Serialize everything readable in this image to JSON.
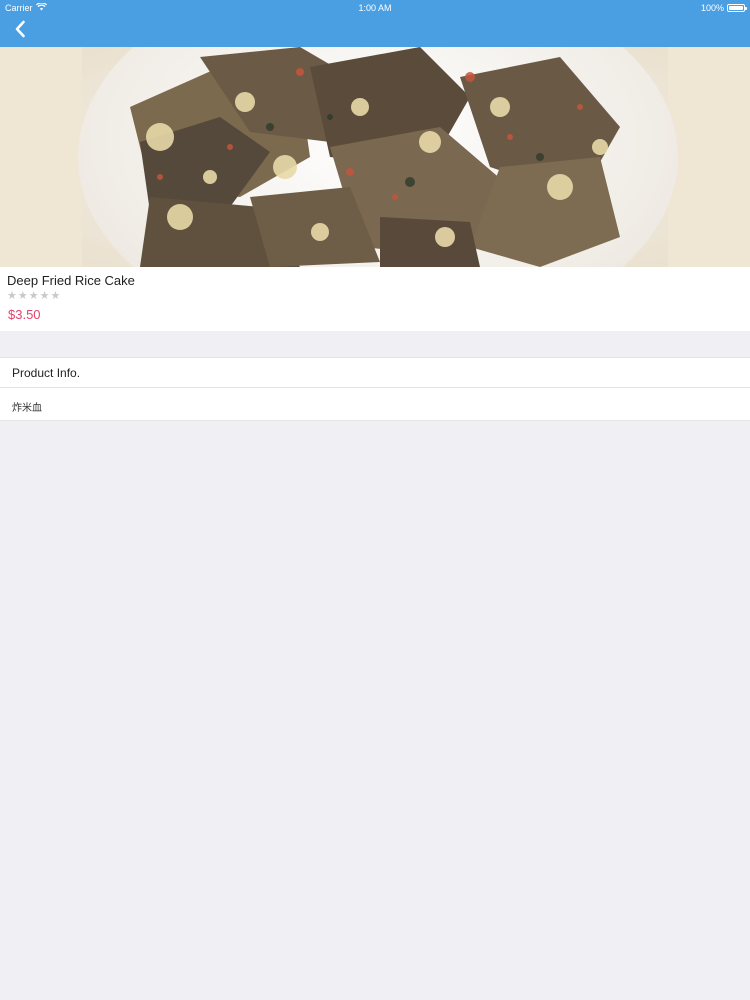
{
  "status_bar": {
    "carrier": "Carrier",
    "time": "1:00 AM",
    "battery": "100%",
    "wifi_icon": "wifi-icon",
    "battery_icon": "battery-icon"
  },
  "nav": {
    "back_icon": "chevron-left-icon",
    "bar_color": "#4a9fe3"
  },
  "product": {
    "name": "Deep Fried Rice Cake",
    "rating_value": 0,
    "rating_max": 5,
    "price": "$3.50",
    "price_color": "#e2446b",
    "image_icon": "product-photo"
  },
  "product_info": {
    "title": "Product Info.",
    "description": "炸米血"
  }
}
